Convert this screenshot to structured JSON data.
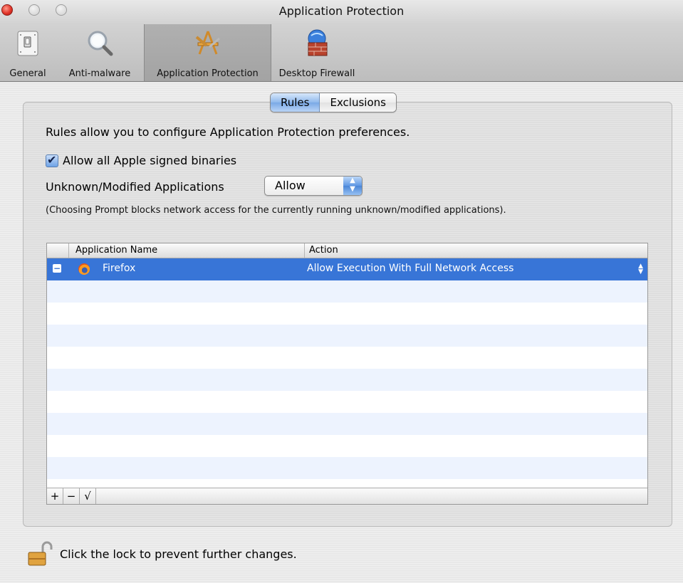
{
  "window": {
    "title": "Application Protection"
  },
  "toolbar": {
    "items": [
      {
        "label": "General",
        "icon": "switch-icon"
      },
      {
        "label": "Anti-malware",
        "icon": "magnifier-icon"
      },
      {
        "label": "Application Protection",
        "icon": "app-protection-icon",
        "selected": true
      },
      {
        "label": "Desktop Firewall",
        "icon": "firewall-globe-icon"
      }
    ]
  },
  "tabs": {
    "rules": "Rules",
    "exclusions": "Exclusions",
    "selected": "Rules"
  },
  "rules": {
    "description": "Rules allow you to configure Application Protection preferences.",
    "allow_apple_label": "Allow all Apple signed binaries",
    "allow_apple_checked": true,
    "unknown_label": "Unknown/Modified Applications",
    "unknown_value": "Allow",
    "note": "(Choosing Prompt blocks network access for the currently running unknown/modified applications)."
  },
  "table": {
    "headers": [
      "Application Name",
      "Action"
    ],
    "rows": [
      {
        "name": "Firefox",
        "action": "Allow Execution With Full Network Access",
        "selected": true
      }
    ],
    "buttons": [
      "+",
      "−",
      "√"
    ]
  },
  "lock": {
    "text": "Click the lock to prevent further changes."
  },
  "colors": {
    "selection": "#3875d7",
    "stripe": "#edf3fe"
  }
}
